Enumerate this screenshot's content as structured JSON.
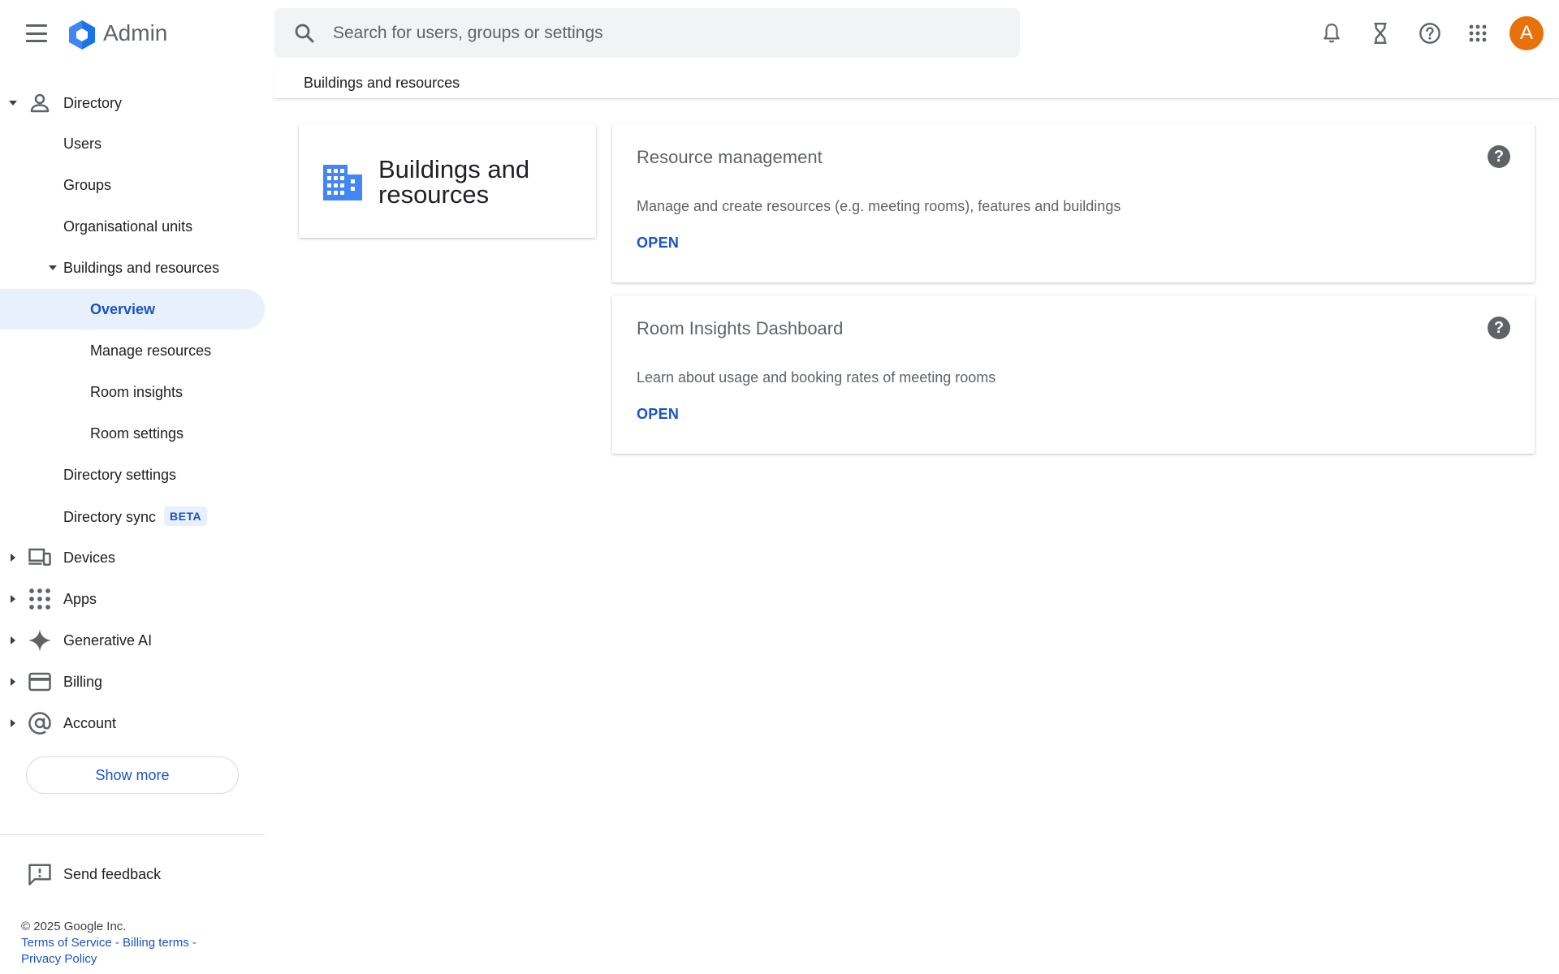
{
  "app": {
    "title": "Admin"
  },
  "search": {
    "placeholder": "Search for users, groups or settings"
  },
  "user": {
    "avatar_letter": "A",
    "avatar_color": "#e8710a"
  },
  "breadcrumb": {
    "current": "Buildings and resources"
  },
  "sidebar": {
    "directory": "Directory",
    "users": "Users",
    "groups": "Groups",
    "org_units": "Organisational units",
    "buildings": "Buildings and resources",
    "overview": "Overview",
    "manage_resources": "Manage resources",
    "room_insights": "Room insights",
    "room_settings": "Room settings",
    "directory_settings": "Directory settings",
    "directory_sync": "Directory sync",
    "beta_badge": "BETA",
    "devices": "Devices",
    "apps": "Apps",
    "generative_ai": "Generative AI",
    "billing": "Billing",
    "account": "Account",
    "show_more": "Show more",
    "send_feedback": "Send feedback"
  },
  "footer": {
    "copyright": "© 2025 Google Inc.",
    "terms": "Terms of Service",
    "billing_terms": "Billing terms",
    "privacy": "Privacy Policy",
    "separator": " - "
  },
  "main": {
    "title_card": {
      "title": "Buildings and resources"
    },
    "cards": [
      {
        "title": "Resource management",
        "description": "Manage and create resources (e.g. meeting rooms), features and buildings",
        "action": "OPEN"
      },
      {
        "title": "Room Insights Dashboard",
        "description": "Learn about usage and booking rates of meeting rooms",
        "action": "OPEN"
      }
    ]
  },
  "colors": {
    "accent": "#1a53c6",
    "active_bg": "#e8f0fe",
    "logo_blue": "#4285f4"
  }
}
